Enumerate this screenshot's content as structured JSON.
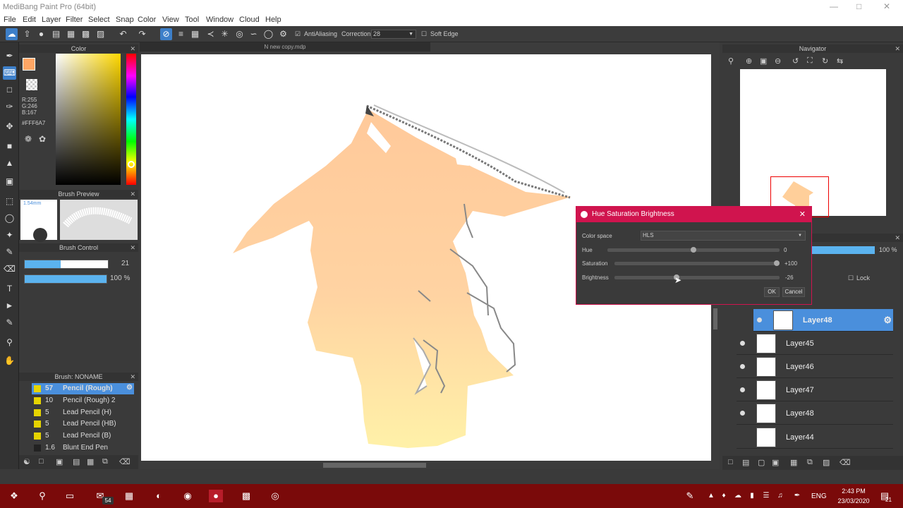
{
  "window": {
    "title": "MediBang Paint Pro (64bit)"
  },
  "menu": [
    "File",
    "Edit",
    "Layer",
    "Filter",
    "Select",
    "Snap",
    "Color",
    "View",
    "Tool",
    "Window",
    "Cloud",
    "Help"
  ],
  "toolbar": {
    "antialiasing": "AntiAliasing",
    "correction_label": "Correction",
    "correction_value": "28",
    "soft_edge": "Soft Edge"
  },
  "color_panel": {
    "title": "Color",
    "r": "R:255",
    "g": "G:246",
    "b": "B:167",
    "hex": "#FFF6A7",
    "fg_color": "#ffa765"
  },
  "brush_preview": {
    "title": "Brush Preview",
    "size": "1.54mm"
  },
  "brush_control": {
    "title": "Brush Control",
    "size_value": "21",
    "size_fraction": 0.43,
    "opacity_value": "100 %",
    "opacity_fraction": 1.0
  },
  "brush_list": {
    "title": "Brush: NONAME",
    "items": [
      {
        "num": "57",
        "name": "Pencil (Rough)",
        "selected": true
      },
      {
        "num": "10",
        "name": "Pencil (Rough) 2"
      },
      {
        "num": "5",
        "name": "Lead Pencil (H)"
      },
      {
        "num": "5",
        "name": "Lead Pencil (HB)"
      },
      {
        "num": "5",
        "name": "Lead Pencil (B)"
      },
      {
        "num": "1.6",
        "name": "Blunt End Pen"
      }
    ]
  },
  "document": {
    "tab": "N new copy.mdp"
  },
  "navigator": {
    "title": "Navigator"
  },
  "layers": {
    "opacity": "100 %",
    "lock": "Lock",
    "items": [
      {
        "name": "Layer48",
        "selected": true
      },
      {
        "name": "Layer45"
      },
      {
        "name": "Layer46"
      },
      {
        "name": "Layer47"
      },
      {
        "name": "Layer48"
      },
      {
        "name": "Layer44"
      }
    ]
  },
  "dialog": {
    "title": "Hue Saturation Brightness",
    "color_space_label": "Color space",
    "color_space_value": "HLS",
    "hue_label": "Hue",
    "hue_value": "0",
    "hue_fraction": 0.5,
    "saturation_label": "Saturation",
    "saturation_value": "+100",
    "saturation_fraction": 1.0,
    "brightness_label": "Brightness",
    "brightness_value": "-26",
    "brightness_fraction": 0.37,
    "ok": "OK",
    "cancel": "Cancel"
  },
  "taskbar": {
    "mail_badge": "54",
    "language": "ENG",
    "time": "2:43 PM",
    "date": "23/03/2020",
    "notifications": "21"
  }
}
